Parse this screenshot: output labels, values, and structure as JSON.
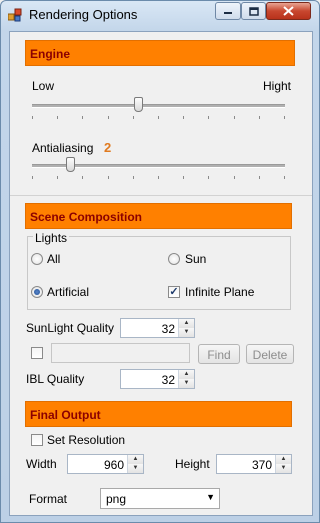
{
  "window": {
    "title": "Rendering Options",
    "controls": [
      "minimize-icon",
      "maximize-icon",
      "close-icon"
    ]
  },
  "engine": {
    "header": "Engine",
    "quality_low_label": "Low",
    "quality_high_label": "Hight",
    "quality_level": 0.42,
    "antialiasing_label": "Antialiasing",
    "antialiasing_value": "2",
    "antialiasing_level": 0.14
  },
  "scene": {
    "header": "Scene Composition",
    "lights_group_label": "Lights",
    "radio_all_label": "All",
    "radio_sun_label": "Sun",
    "radio_artificial_label": "Artificial",
    "radio_selected": "Artificial",
    "infinite_plane_label": "Infinite Plane",
    "infinite_plane_checked": true,
    "sunlight_quality_label": "SunLight Quality",
    "sunlight_quality_value": "32",
    "find_enabled_checked": false,
    "find_text": "",
    "find_button_label": "Find",
    "delete_button_label": "Delete",
    "ibl_quality_label": "IBL Quality",
    "ibl_quality_value": "32"
  },
  "output": {
    "header": "Final Output",
    "set_resolution_label": "Set Resolution",
    "set_resolution_checked": false,
    "width_label": "Width",
    "width_value": "960",
    "height_label": "Height",
    "height_value": "370",
    "format_label": "Format",
    "format_value": "png"
  },
  "colors": {
    "header_bg": "#ff8000",
    "header_text": "#8b0000",
    "antialiasing_value": "#e07a1f"
  }
}
